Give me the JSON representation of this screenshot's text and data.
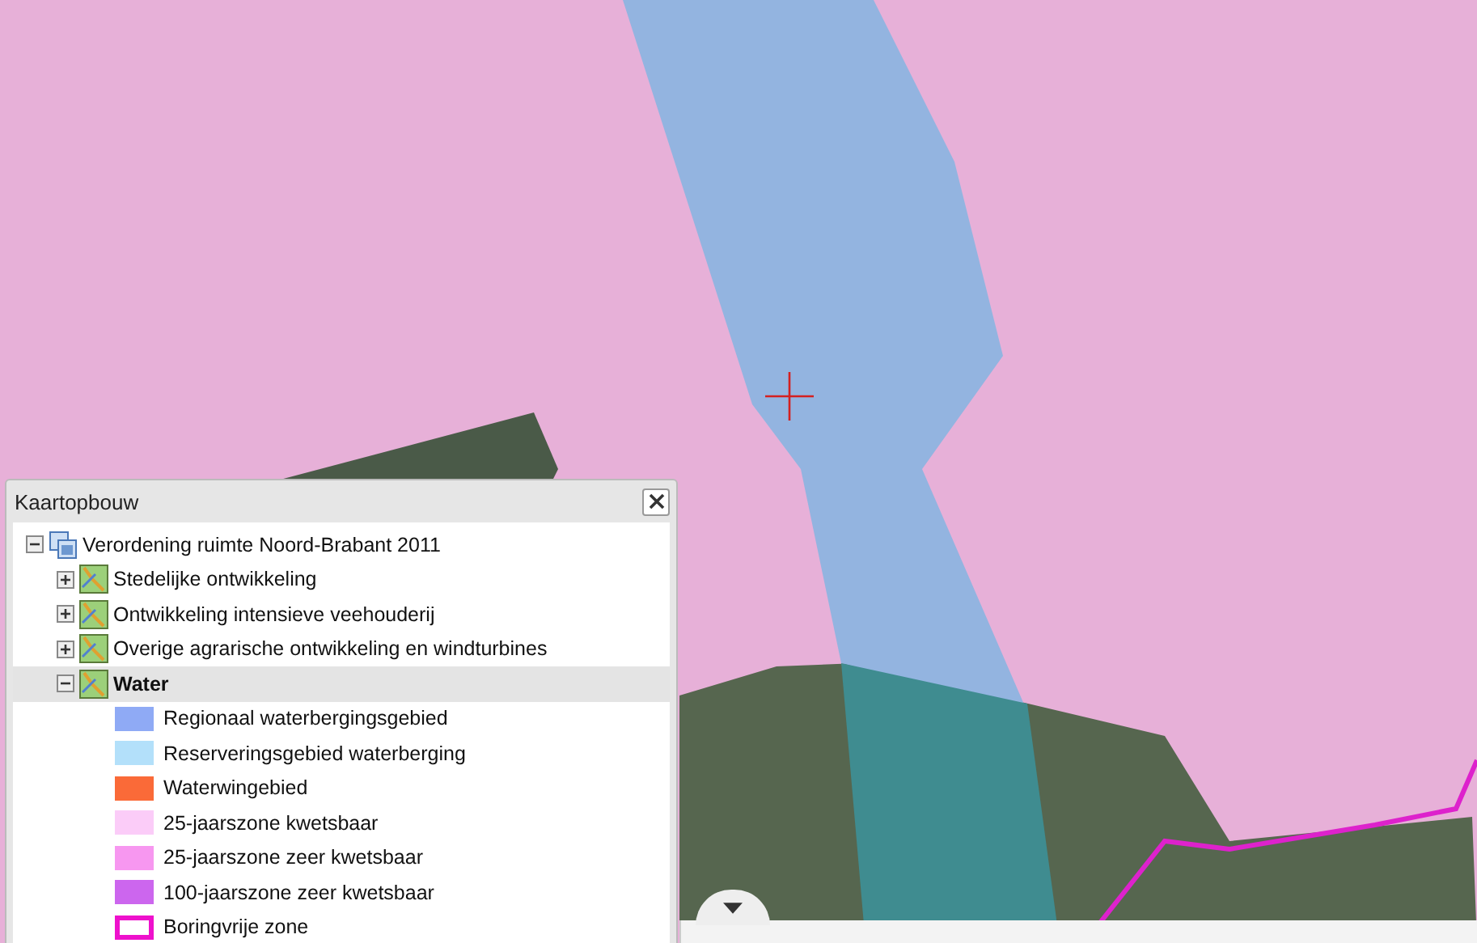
{
  "drawer": {
    "expanded": false
  },
  "panel": {
    "title": "Kaartopbouw",
    "tree": [
      {
        "label": "Verordening ruimte Noord-Brabant 2011",
        "kind": "service",
        "expanded": true,
        "selected": false,
        "children": [
          {
            "label": "Stedelijke ontwikkeling",
            "kind": "layer",
            "expanded": false,
            "selected": false
          },
          {
            "label": "Ontwikkeling intensieve veehouderij",
            "kind": "layer",
            "expanded": false,
            "selected": false
          },
          {
            "label": "Overige agrarische ontwikkeling en windturbines",
            "kind": "layer",
            "expanded": false,
            "selected": false
          },
          {
            "label": "Water",
            "kind": "layer",
            "expanded": true,
            "selected": true,
            "legend": [
              {
                "label": "Regionaal waterbergingsgebied",
                "kind": "fill",
                "color": "#8faaf5"
              },
              {
                "label": "Reserveringsgebied waterberging",
                "kind": "fill",
                "color": "#b3e0fa"
              },
              {
                "label": "Waterwingebied",
                "kind": "fill",
                "color": "#fa6a38"
              },
              {
                "label": "25-jaarszone kwetsbaar",
                "kind": "fill",
                "color": "#fbccf8"
              },
              {
                "label": "25-jaarszone zeer kwetsbaar",
                "kind": "fill",
                "color": "#f797f0"
              },
              {
                "label": "100-jaarszone zeer kwetsbaar",
                "kind": "fill",
                "color": "#cc66ee"
              },
              {
                "label": "Boringvrije zone",
                "kind": "outline",
                "color": "#ee11cc"
              }
            ]
          }
        ]
      }
    ]
  }
}
